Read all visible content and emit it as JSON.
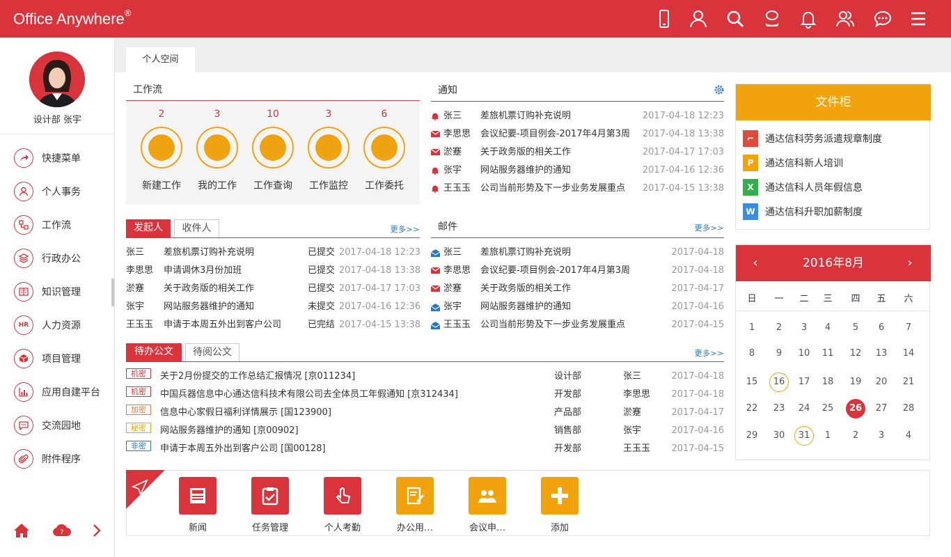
{
  "app": {
    "title": "Office Anywhere",
    "reg": "®"
  },
  "topbar": {
    "icons": [
      "mobile-icon",
      "user-icon",
      "search-icon",
      "contacts-icon",
      "bell-icon",
      "group-icon",
      "chat-icon",
      "menu-icon"
    ]
  },
  "user": {
    "dept_name": "设计部  张宇"
  },
  "sidebar": {
    "items": [
      {
        "label": "快捷菜单",
        "icon": "share-icon"
      },
      {
        "label": "个人事务",
        "icon": "person-icon"
      },
      {
        "label": "工作流",
        "icon": "workflow-icon"
      },
      {
        "label": "行政办公",
        "icon": "layers-icon"
      },
      {
        "label": "知识管理",
        "icon": "book-icon"
      },
      {
        "label": "人力资源",
        "icon": "hr-icon"
      },
      {
        "label": "项目管理",
        "icon": "box-icon"
      },
      {
        "label": "应用自建平台",
        "icon": "chart-icon"
      },
      {
        "label": "交流园地",
        "icon": "message-icon"
      },
      {
        "label": "附件程序",
        "icon": "paperclip-icon"
      }
    ]
  },
  "tabs": {
    "personal_space": "个人空间"
  },
  "workflow": {
    "title": "工作流",
    "items": [
      {
        "count": "2",
        "label": "新建工作"
      },
      {
        "count": "3",
        "label": "我的工作"
      },
      {
        "count": "10",
        "label": "工作查询"
      },
      {
        "count": "3",
        "label": "工作监控"
      },
      {
        "count": "6",
        "label": "工作委托"
      }
    ]
  },
  "notice": {
    "title": "通知",
    "rows": [
      {
        "type": "bell",
        "sender": "张三",
        "subject": "差旅机票订购补充说明",
        "time": "2017-04-18 12:23"
      },
      {
        "type": "mail",
        "sender": "李思思",
        "subject": "会议纪要-项目例会-2017年4月第3周",
        "time": "2017-04-18 13:38"
      },
      {
        "type": "mail",
        "sender": "淤蹇",
        "subject": "关于政务版的相关工作",
        "time": "2017-04-17 17:03"
      },
      {
        "type": "bell",
        "sender": "张宇",
        "subject": "网站服务器维护的通知",
        "time": "2017-04-16 12:36"
      },
      {
        "type": "bell",
        "sender": "王玉玉",
        "subject": "公司当前形势及下一步业务发展重点",
        "time": "2017-04-15 13:38"
      }
    ]
  },
  "initiator": {
    "tab_on": "发起人",
    "tab_off": "收件人",
    "more": "更多>>",
    "rows": [
      {
        "name": "张三",
        "subject": "差旅机票订购补充说明",
        "status": "已提交",
        "time": "2017-04-18 12:23"
      },
      {
        "name": "李思思",
        "subject": "申请调休3月份加班",
        "status": "已提交",
        "time": "2017-04-18 13:38"
      },
      {
        "name": "淤蹇",
        "subject": "关于政务版的相关工作",
        "status": "已提交",
        "time": "2017-04-17 17:03"
      },
      {
        "name": "张宇",
        "subject": "网站服务器维护的通知",
        "status": "未提交",
        "time": "2017-04-16 12:36"
      },
      {
        "name": "王玉玉",
        "subject": "申请于本周五外出到客户公司",
        "status": "已完结",
        "time": "2017-04-15 13:38"
      }
    ]
  },
  "mail": {
    "title": "邮件",
    "more": "更多>>",
    "rows": [
      {
        "type": "open",
        "sender": "张三",
        "subject": "差旅机票订购补充说明",
        "date": "2017-04-18"
      },
      {
        "type": "closed",
        "sender": "李思思",
        "subject": "会议纪要-项目例会-2017年4月第3周",
        "date": "2017-04-18"
      },
      {
        "type": "closed",
        "sender": "淤蹇",
        "subject": "关于政务版的相关工作",
        "date": "2017-04-17"
      },
      {
        "type": "open",
        "sender": "张宇",
        "subject": "网站服务器维护的通知",
        "date": "2017-04-16"
      },
      {
        "type": "open",
        "sender": "王玉玉",
        "subject": "公司当前形势及下一步业务发展重点",
        "date": "2017-04-15"
      }
    ]
  },
  "docs": {
    "tab_on": "待办公文",
    "tab_off": "待阅公文",
    "more": "更多>>",
    "rows": [
      {
        "level": "机密",
        "color": "#d9343c",
        "title": "关于2月份提交的工作总结汇报情况 [京011234]",
        "dept": "设计部",
        "person": "张三",
        "date": "2017-04-18"
      },
      {
        "level": "机密",
        "color": "#d9343c",
        "title": "中国兵器信息中心通达信科技术有限公司去全体员工年假通知 [京312434]",
        "dept": "开发部",
        "person": "李思思",
        "date": "2017-04-18"
      },
      {
        "level": "加密",
        "color": "#e07a3a",
        "title": "信息中心家假日福利详情展示 [国123900]",
        "dept": "产品部",
        "person": "淤蹇",
        "date": "2017-04-17"
      },
      {
        "level": "秘密",
        "color": "#f0a30c",
        "title": "网站服务器维护的通知 [京00902]",
        "dept": "销售部",
        "person": "张宇",
        "date": "2017-04-16"
      },
      {
        "level": "非密",
        "color": "#2878c8",
        "title": "申请于本周五外出到客户公司 [国00128]",
        "dept": "开发部",
        "person": "王玉玉",
        "date": "2017-04-15"
      }
    ]
  },
  "cabinet": {
    "title": "文件柜",
    "items": [
      {
        "type": "pdf",
        "color": "#e04a3a",
        "glyph": "⌐",
        "label": "通达信科劳务派遣规章制度"
      },
      {
        "type": "ppt",
        "color": "#f0a30c",
        "glyph": "P",
        "label": "通达信科新人培训"
      },
      {
        "type": "xls",
        "color": "#2fb24a",
        "glyph": "X",
        "label": "通达信科人员年假信息"
      },
      {
        "type": "doc",
        "color": "#3a8ee0",
        "glyph": "W",
        "label": "通达信科升职加薪制度"
      }
    ]
  },
  "calendar": {
    "title": "2016年8月",
    "prev": "‹",
    "next": "›",
    "weekdays": [
      "日",
      "一",
      "二",
      "三",
      "四",
      "五",
      "六"
    ],
    "weeks": [
      [
        "1",
        "2",
        "3",
        "4",
        "5",
        "6",
        "7"
      ],
      [
        "8",
        "9",
        "10",
        "11",
        "12",
        "13",
        "14"
      ],
      [
        "15",
        "16",
        "17",
        "18",
        "19",
        "20",
        "21"
      ],
      [
        "22",
        "23",
        "24",
        "25",
        "26",
        "27",
        "28"
      ],
      [
        "29",
        "30",
        "31",
        "1",
        "2",
        "3",
        "4"
      ]
    ],
    "today": "26",
    "marked": [
      "16",
      "31"
    ]
  },
  "quick": {
    "items": [
      {
        "label": "新闻",
        "color": "#d9343c",
        "icon": "news-icon"
      },
      {
        "label": "任务管理",
        "color": "#d9343c",
        "icon": "clipboard-check-icon"
      },
      {
        "label": "个人考勤",
        "color": "#d9343c",
        "icon": "touch-icon"
      },
      {
        "label": "办公用…",
        "color": "#f0a30c",
        "icon": "edit-doc-icon"
      },
      {
        "label": "会议申…",
        "color": "#f0a30c",
        "icon": "meeting-icon"
      },
      {
        "label": "添加",
        "color": "#f0a30c",
        "icon": "plus-icon"
      }
    ]
  }
}
